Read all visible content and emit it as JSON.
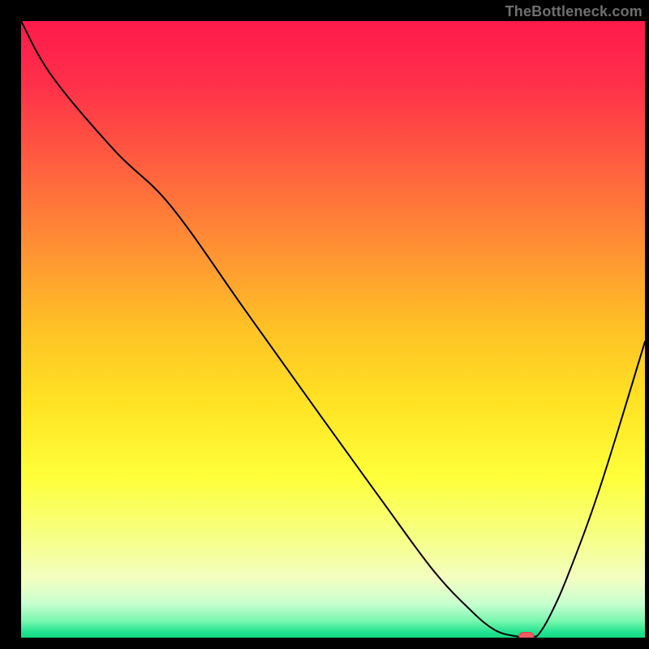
{
  "watermark": "TheBottleneck.com",
  "colors": {
    "background": "#000000",
    "gradient_stops": [
      {
        "offset": 0.0,
        "color": "#ff1a4c"
      },
      {
        "offset": 0.1,
        "color": "#ff2f4a"
      },
      {
        "offset": 0.22,
        "color": "#ff5a40"
      },
      {
        "offset": 0.35,
        "color": "#ff8a35"
      },
      {
        "offset": 0.5,
        "color": "#ffc225"
      },
      {
        "offset": 0.62,
        "color": "#ffe324"
      },
      {
        "offset": 0.74,
        "color": "#ffff3a"
      },
      {
        "offset": 0.84,
        "color": "#f6ff87"
      },
      {
        "offset": 0.905,
        "color": "#f2ffc2"
      },
      {
        "offset": 0.945,
        "color": "#c8ffd0"
      },
      {
        "offset": 0.972,
        "color": "#7cf7b0"
      },
      {
        "offset": 0.992,
        "color": "#1ee28e"
      },
      {
        "offset": 1.0,
        "color": "#14d884"
      }
    ],
    "curve": "#000000",
    "marker_fill": "#ef5a64",
    "marker_stroke": "#d8434e",
    "watermark": "#6f6f6f"
  },
  "chart_data": {
    "type": "line",
    "title": "",
    "xlabel": "",
    "ylabel": "",
    "xlim": [
      0,
      100
    ],
    "ylim": [
      0,
      100
    ],
    "x": [
      0,
      5,
      15,
      24,
      36,
      48,
      58,
      66,
      72,
      76,
      79.5,
      80.5,
      82,
      83,
      85,
      88,
      93,
      100
    ],
    "values": [
      100,
      91,
      79,
      70,
      53,
      36,
      22,
      11,
      4.5,
      1.2,
      0.2,
      0.2,
      0.2,
      0.6,
      4,
      11,
      25,
      48
    ],
    "marker": {
      "x": 81,
      "y": 0.2
    },
    "note": "y is bottleneck percentage; values estimated from pixel positions"
  }
}
